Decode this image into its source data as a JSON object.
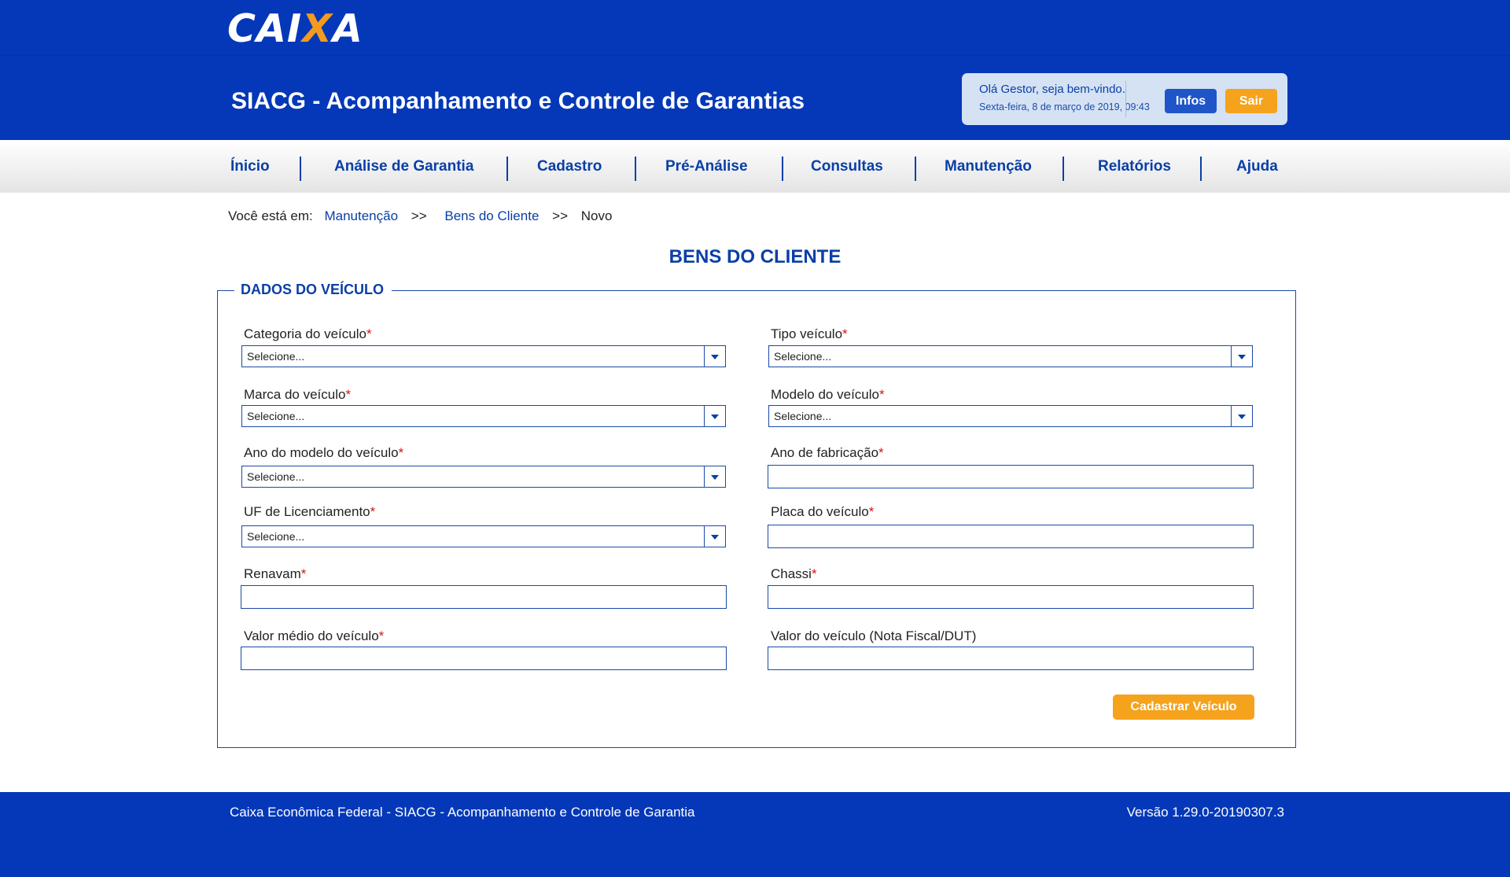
{
  "brand": {
    "logo_text_a": "CAI",
    "logo_text_x": "X",
    "logo_text_b": "A",
    "accent": "#f29b1d",
    "primary": "#0538b8"
  },
  "header": {
    "title": "SIACG - Acompanhamento e Controle de Garantias",
    "greeting": "Olá Gestor, seja bem-vindo.",
    "datetime": "Sexta-feira, 8 de março de 2019, 09:43",
    "infos_label": "Infos",
    "sair_label": "Sair"
  },
  "nav": {
    "items": [
      "Ínicio",
      "Análise de Garantia",
      "Cadastro",
      "Pré-Análise",
      "Consultas",
      "Manutenção",
      "Relatórios",
      "Ajuda"
    ]
  },
  "breadcrumb": {
    "prefix": "Você está em:",
    "items": [
      "Manutenção",
      "Bens do Cliente",
      "Novo"
    ],
    "separator": ">>"
  },
  "page": {
    "title": "BENS DO CLIENTE",
    "section_title": "DADOS DO VEÍCULO",
    "required_mark": "*",
    "submit_label": "Cadastrar Veículo"
  },
  "form": {
    "categoria": {
      "label": "Categoria do veículo",
      "value": "Selecione..."
    },
    "tipo": {
      "label": "Tipo veículo",
      "value": "Selecione..."
    },
    "marca": {
      "label": "Marca do veículo",
      "value": "Selecione..."
    },
    "modelo": {
      "label": "Modelo do veículo",
      "value": "Selecione..."
    },
    "ano_modelo": {
      "label": "Ano do modelo do veículo",
      "value": "Selecione..."
    },
    "ano_fabricacao": {
      "label": "Ano de fabricação",
      "value": ""
    },
    "uf": {
      "label": "UF de Licenciamento",
      "value": "Selecione..."
    },
    "placa": {
      "label": "Placa do veículo",
      "value": ""
    },
    "renavam": {
      "label": "Renavam",
      "value": ""
    },
    "chassi": {
      "label": "Chassi",
      "value": ""
    },
    "valor_medio": {
      "label": "Valor médio do veículo",
      "value": ""
    },
    "valor_nf": {
      "label": "Valor do veículo (Nota Fiscal/DUT)",
      "value": ""
    }
  },
  "footer": {
    "left": "Caixa Econômica Federal - SIACG - Acompanhamento e Controle de Garantia",
    "right": "Versão 1.29.0-20190307.3"
  }
}
